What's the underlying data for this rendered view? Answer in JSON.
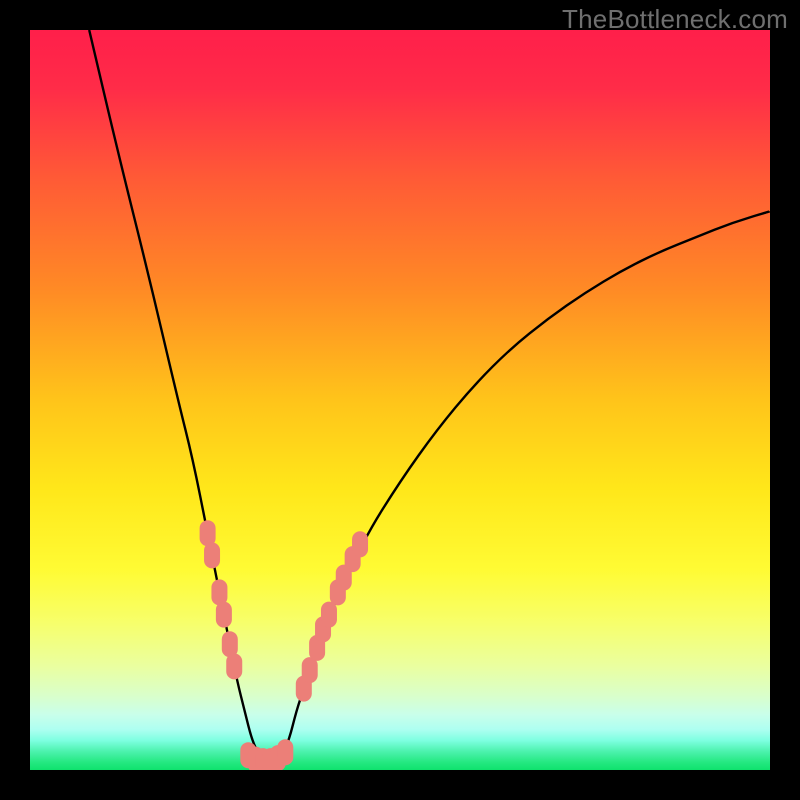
{
  "watermark": "TheBottleneck.com",
  "colors": {
    "frame": "#000000",
    "curve": "#000000",
    "marker": "#ec7f78",
    "gradient_stops": [
      {
        "offset": 0.0,
        "color": "#ff1f4a"
      },
      {
        "offset": 0.08,
        "color": "#ff2c48"
      },
      {
        "offset": 0.2,
        "color": "#ff5a36"
      },
      {
        "offset": 0.35,
        "color": "#ff8a25"
      },
      {
        "offset": 0.5,
        "color": "#ffc41a"
      },
      {
        "offset": 0.62,
        "color": "#ffe71a"
      },
      {
        "offset": 0.73,
        "color": "#fffb34"
      },
      {
        "offset": 0.8,
        "color": "#f7ff6a"
      },
      {
        "offset": 0.86,
        "color": "#eaffa0"
      },
      {
        "offset": 0.9,
        "color": "#d9ffcb"
      },
      {
        "offset": 0.925,
        "color": "#c9ffea"
      },
      {
        "offset": 0.945,
        "color": "#aefff1"
      },
      {
        "offset": 0.96,
        "color": "#7effe1"
      },
      {
        "offset": 0.975,
        "color": "#4cf2ad"
      },
      {
        "offset": 0.99,
        "color": "#23e880"
      },
      {
        "offset": 1.0,
        "color": "#0fe26d"
      }
    ]
  },
  "chart_data": {
    "type": "line",
    "title": "",
    "xlabel": "",
    "ylabel": "",
    "xlim": [
      0,
      100
    ],
    "ylim": [
      0,
      100
    ],
    "series": [
      {
        "name": "bottleneck-curve",
        "x": [
          8,
          12,
          16,
          20,
          22,
          24,
          26,
          27,
          28,
          29,
          30,
          31,
          32,
          33,
          34,
          35,
          36,
          37,
          40,
          45,
          50,
          55,
          60,
          65,
          70,
          75,
          80,
          85,
          90,
          95,
          100
        ],
        "y": [
          100,
          83,
          67,
          50,
          42,
          32,
          22,
          17,
          12,
          8,
          4,
          2,
          1,
          1,
          2,
          4,
          8,
          11,
          20,
          31,
          39,
          46,
          52,
          57,
          61,
          64.5,
          67.5,
          70,
          72,
          74,
          75.5
        ]
      }
    ],
    "markers": {
      "name": "highlighted-points",
      "points": [
        {
          "x": 24.0,
          "y": 32.0
        },
        {
          "x": 24.6,
          "y": 29.0
        },
        {
          "x": 25.6,
          "y": 24.0
        },
        {
          "x": 26.2,
          "y": 21.0
        },
        {
          "x": 27.0,
          "y": 17.0
        },
        {
          "x": 27.6,
          "y": 14.0
        },
        {
          "x": 29.5,
          "y": 2.0
        },
        {
          "x": 30.5,
          "y": 1.4
        },
        {
          "x": 31.5,
          "y": 1.2
        },
        {
          "x": 32.5,
          "y": 1.2
        },
        {
          "x": 33.5,
          "y": 1.6
        },
        {
          "x": 34.5,
          "y": 2.4
        },
        {
          "x": 37.0,
          "y": 11.0
        },
        {
          "x": 37.8,
          "y": 13.5
        },
        {
          "x": 38.8,
          "y": 16.5
        },
        {
          "x": 39.6,
          "y": 19.0
        },
        {
          "x": 40.4,
          "y": 21.0
        },
        {
          "x": 41.6,
          "y": 24.0
        },
        {
          "x": 42.4,
          "y": 26.0
        },
        {
          "x": 43.6,
          "y": 28.5
        },
        {
          "x": 44.6,
          "y": 30.5
        }
      ]
    }
  }
}
